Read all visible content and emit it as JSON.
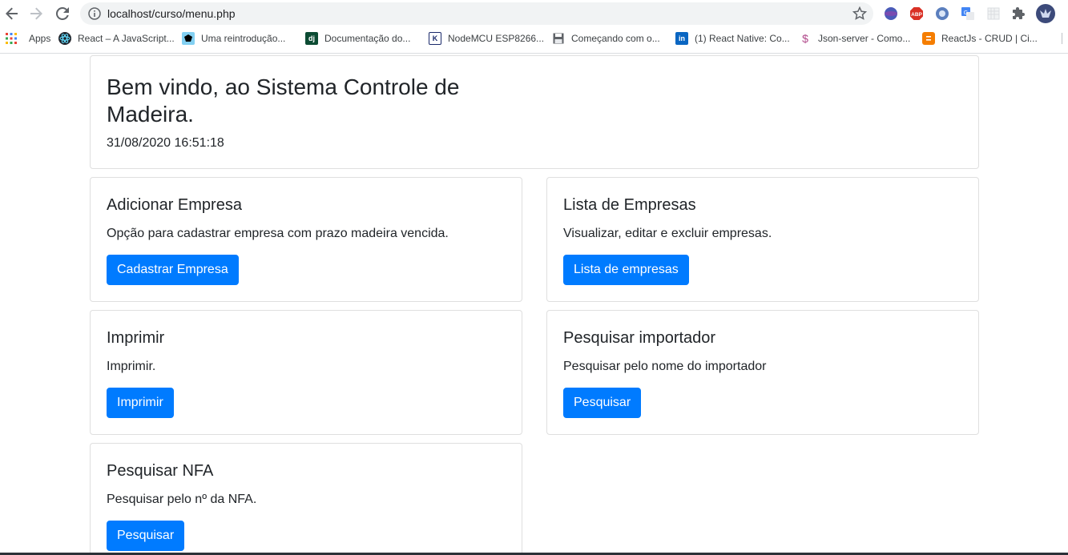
{
  "browser": {
    "url": "localhost/curso/menu.php",
    "bookmarks": [
      {
        "label": "Apps",
        "icon": "apps-grid-icon"
      },
      {
        "label": "React – A JavaScript...",
        "icon": "react-icon"
      },
      {
        "label": "Uma reintrodução...",
        "icon": "mdn-icon"
      },
      {
        "label": "Documentação do...",
        "icon": "django-icon"
      },
      {
        "label": "NodeMCU ESP8266...",
        "icon": "k-icon"
      },
      {
        "label": "Começando com o...",
        "icon": "floppy-icon"
      },
      {
        "label": "(1) React Native: Co...",
        "icon": "linkedin-icon"
      },
      {
        "label": "Json-server - Como...",
        "icon": "dollar-icon"
      },
      {
        "label": "ReactJs - CRUD | Ci...",
        "icon": "blogger-icon"
      }
    ],
    "extensions": [
      "globe-extension-icon",
      "adblock-icon",
      "circle-extension-icon",
      "translate-icon",
      "grid-extension-icon",
      "puzzle-icon",
      "profile-avatar-icon"
    ],
    "colors": {
      "accent": "#1a73e8",
      "omnibox_bg": "#f1f3f4"
    }
  },
  "page": {
    "welcome": {
      "title": "Bem vindo, ao Sistema Controle de Madeira.",
      "datetime": "31/08/2020 16:51:18"
    },
    "cards": [
      {
        "title": "Adicionar Empresa",
        "text": "Opção para cadastrar empresa com prazo madeira vencida.",
        "button": "Cadastrar Empresa"
      },
      {
        "title": "Lista de Empresas",
        "text": "Visualizar, editar e excluir empresas.",
        "button": "Lista de empresas"
      },
      {
        "title": "Imprimir",
        "text": "Imprimir.",
        "button": "Imprimir"
      },
      {
        "title": "Pesquisar importador",
        "text": "Pesquisar pelo nome do importador",
        "button": "Pesquisar"
      },
      {
        "title": "Pesquisar NFA",
        "text": "Pesquisar pelo nº da NFA.",
        "button": "Pesquisar"
      }
    ],
    "colors": {
      "primary": "#007bff",
      "text": "#212529",
      "border": "rgba(0,0,0,.125)"
    }
  }
}
